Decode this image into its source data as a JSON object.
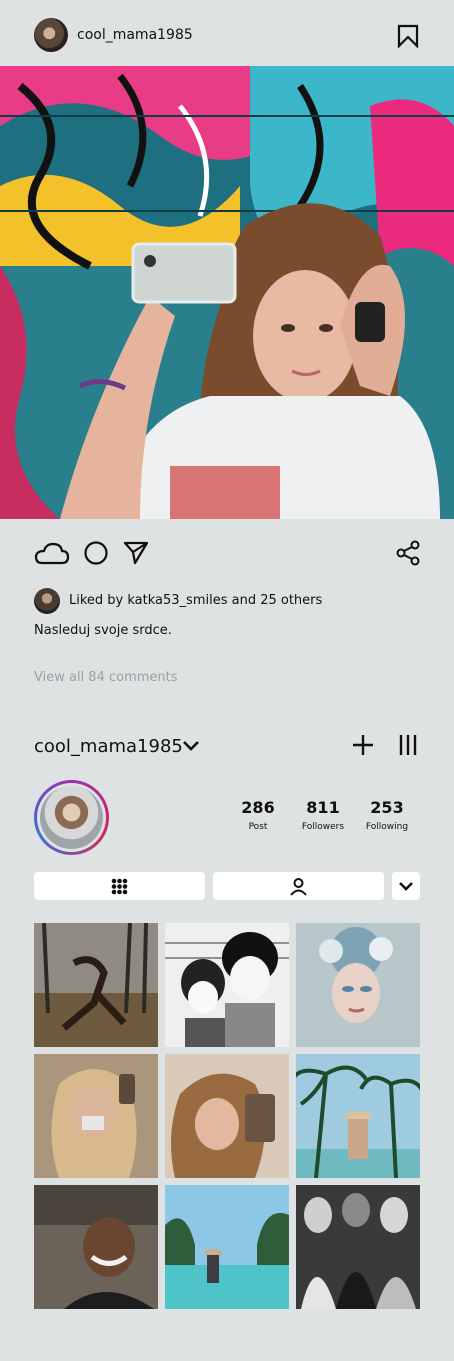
{
  "post": {
    "username": "cool_mama1985",
    "liked_by": "Liked by katka53_smiles and 25 others",
    "caption": "Nasleduj svoje srdce.",
    "view_comments": "View all 84 comments"
  },
  "profile": {
    "username": "cool_mama1985",
    "stats": [
      {
        "value": "286",
        "label": "Post"
      },
      {
        "value": "811",
        "label": "Followers"
      },
      {
        "value": "253",
        "label": "Following"
      }
    ]
  },
  "icons": {
    "bookmark": "bookmark-icon",
    "like": "cloud-icon",
    "comment": "circle-icon",
    "send": "send-icon",
    "share": "share-icon",
    "dropdown": "chevron-down-icon",
    "add": "plus-icon",
    "menu": "menu-icon",
    "grid_tab": "grid-icon",
    "tagged_tab": "person-icon"
  },
  "colors": {
    "background": "#dfe2e2",
    "ring_start": "#9b2fb3",
    "ring_mid": "#d3285a",
    "ring_end": "#3b6fd8"
  }
}
